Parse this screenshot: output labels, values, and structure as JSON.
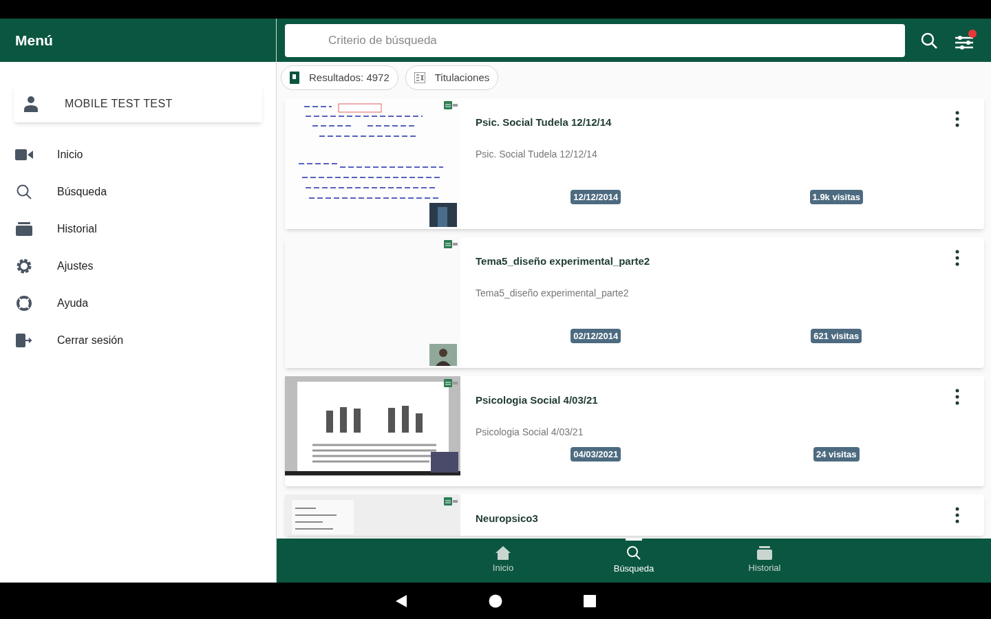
{
  "drawer": {
    "title": "Menú",
    "user": "MOBILE TEST TEST",
    "items": [
      {
        "label": "Inicio"
      },
      {
        "label": "Búsqueda"
      },
      {
        "label": "Historial"
      },
      {
        "label": "Ajustes"
      },
      {
        "label": "Ayuda"
      },
      {
        "label": "Cerrar sesión"
      }
    ]
  },
  "search": {
    "placeholder": "Criterio de búsqueda"
  },
  "chips": [
    {
      "label": "Resultados: 4972"
    },
    {
      "label": "Titulaciones"
    }
  ],
  "results": [
    {
      "title": "Psic. Social Tudela 12/12/14",
      "subtitle": "Psic. Social Tudela 12/12/14",
      "date": "12/12/2014",
      "views": "1.9k visitas"
    },
    {
      "title": "Tema5_diseño experimental_parte2",
      "subtitle": "Tema5_diseño experimental_parte2",
      "date": "02/12/2014",
      "views": "621 visitas"
    },
    {
      "title": "Psicologia Social 4/03/21",
      "subtitle": "Psicologia Social 4/03/21",
      "date": "04/03/2021",
      "views": "24 visitas"
    },
    {
      "title": "Neuropsico3"
    }
  ],
  "bottom_nav": [
    {
      "label": "Inicio",
      "selected": false
    },
    {
      "label": "Búsqueda",
      "selected": true
    },
    {
      "label": "Historial",
      "selected": false
    }
  ]
}
